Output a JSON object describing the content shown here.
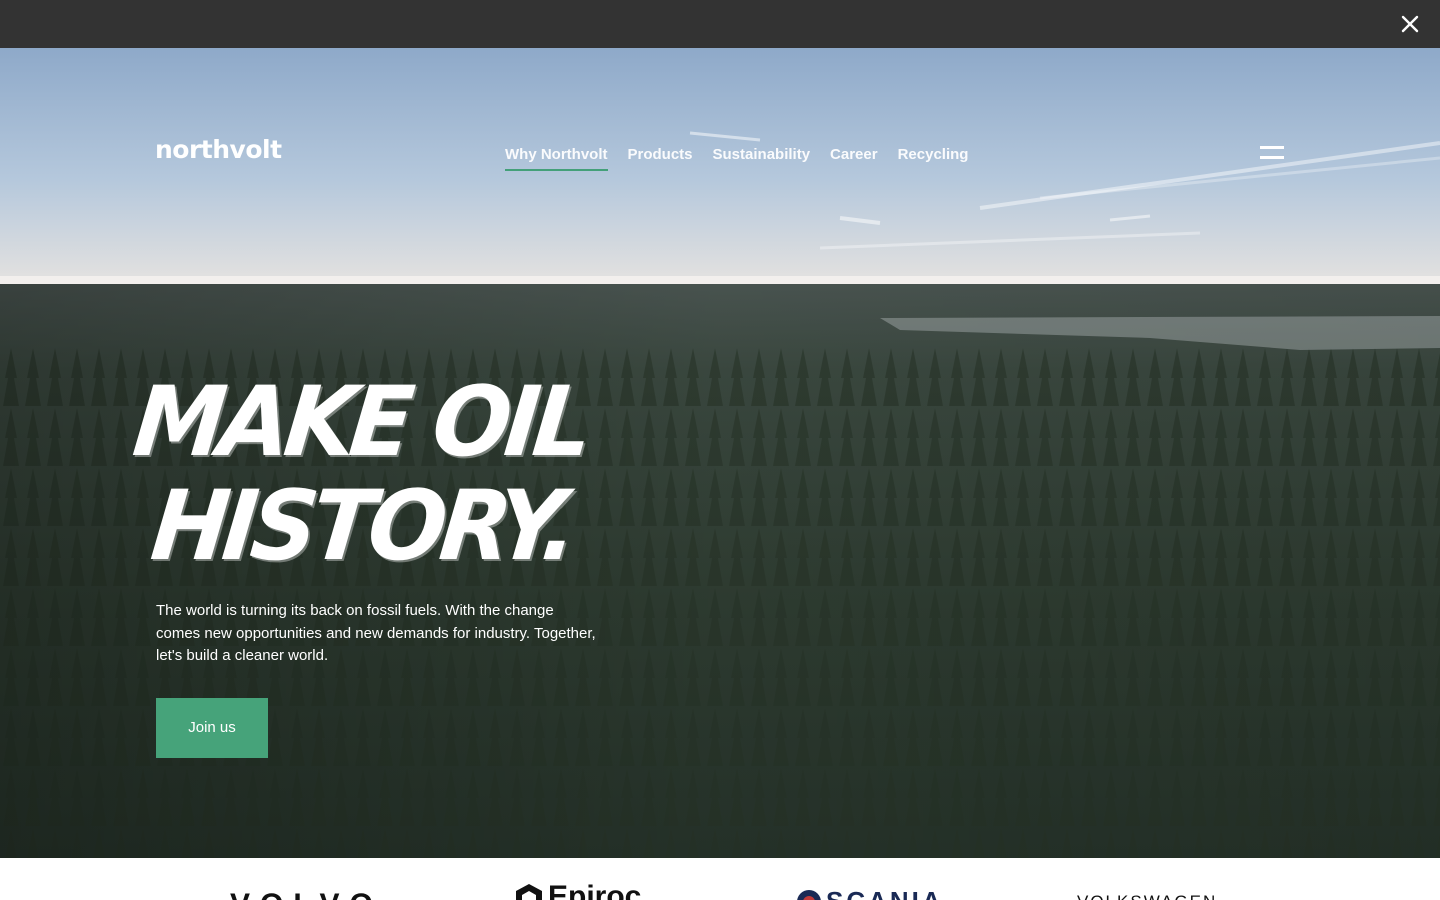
{
  "topbar": {
    "close_icon": "close-icon"
  },
  "header": {
    "logo": "northvolt",
    "nav": [
      {
        "label": "Why Northvolt",
        "active": true
      },
      {
        "label": "Products",
        "active": false
      },
      {
        "label": "Sustainability",
        "active": false
      },
      {
        "label": "Career",
        "active": false
      },
      {
        "label": "Recycling",
        "active": false
      }
    ],
    "menu_icon": "hamburger-menu-icon"
  },
  "hero": {
    "headline_line1": "MAKE OIL",
    "headline_line2": "HISTORY.",
    "intro": "The world is turning its back on fossil fuels. With the change comes new opportunities and new demands for industry. Together, let's build a cleaner world.",
    "cta_label": "Join us"
  },
  "partners": {
    "items": [
      "VOLVO",
      "Epiroc",
      "SCANIA",
      "VOLKSWAGEN"
    ]
  },
  "colors": {
    "topbar": "#333333",
    "accent_green": "#46a37a",
    "nav_underline": "#3e9e74"
  }
}
